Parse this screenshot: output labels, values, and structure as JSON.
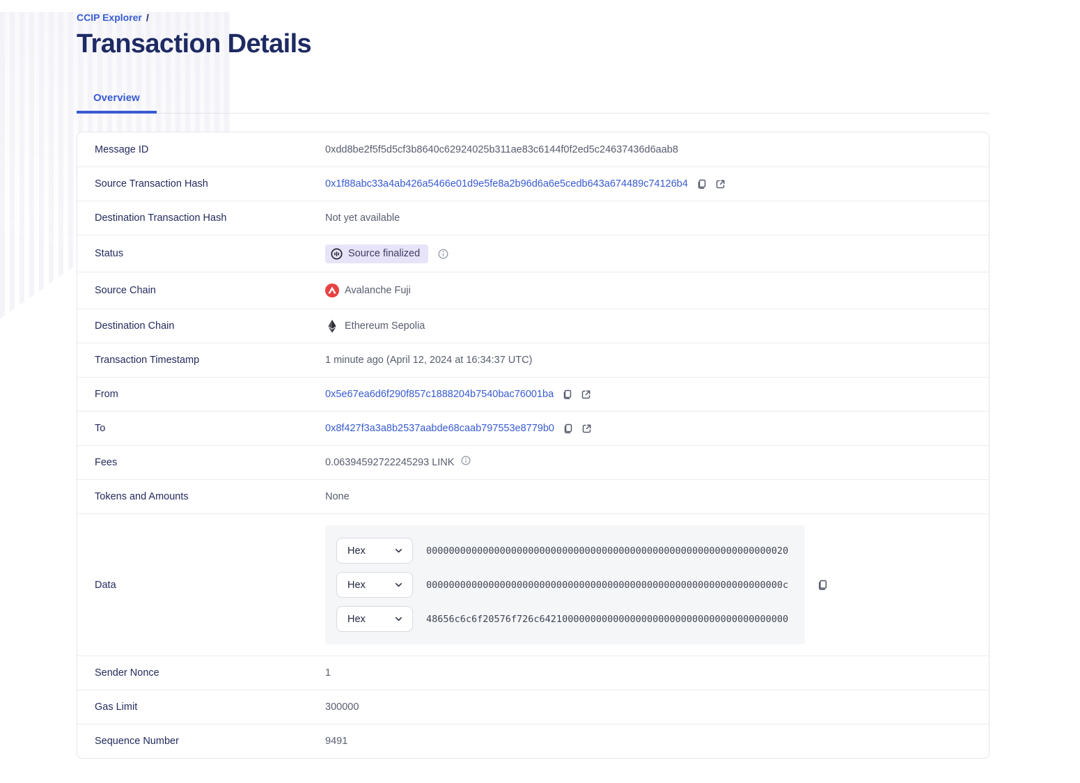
{
  "breadcrumb": {
    "link_label": "CCIP Explorer",
    "separator": "/"
  },
  "page": {
    "title": "Transaction Details"
  },
  "tabs": {
    "overview_label": "Overview"
  },
  "colors": {
    "accent_blue": "#375BD2",
    "heading_navy": "#1E2A63",
    "value_gray": "#575D6F",
    "badge_bg": "#E7E3F9",
    "badge_text": "#3F3D63",
    "avalanche_red": "#E84142",
    "ethereum_dark": "#2B2B33",
    "data_box_bg": "#F5F6F8"
  },
  "rows": {
    "message_id": {
      "label": "Message ID",
      "value": "0xdd8be2f5f5d5cf3b8640c62924025b311ae83c6144f0f2ed5c24637436d6aab8"
    },
    "source_tx": {
      "label": "Source Transaction Hash",
      "value": "0x1f88abc33a4ab426a5466e01d9e5fe8a2b96d6a6e5cedb643a674489c74126b4"
    },
    "dest_tx": {
      "label": "Destination Transaction Hash",
      "value": "Not yet available"
    },
    "status": {
      "label": "Status",
      "badge_label": "Source finalized"
    },
    "source_chain": {
      "label": "Source Chain",
      "value": "Avalanche Fuji"
    },
    "dest_chain": {
      "label": "Destination Chain",
      "value": "Ethereum Sepolia"
    },
    "timestamp": {
      "label": "Transaction Timestamp",
      "value": "1 minute ago (April 12, 2024 at 16:34:37 UTC)"
    },
    "from": {
      "label": "From",
      "value": "0x5e67ea6d6f290f857c1888204b7540bac76001ba"
    },
    "to": {
      "label": "To",
      "value": "0x8f427f3a3a8b2537aabde68caab797553e8779b0"
    },
    "fees": {
      "label": "Fees",
      "value": "0.06394592722245293 LINK"
    },
    "tokens": {
      "label": "Tokens and Amounts",
      "value": "None"
    },
    "data": {
      "label": "Data",
      "encoding": "Hex",
      "lines": [
        "0000000000000000000000000000000000000000000000000000000000000020",
        "000000000000000000000000000000000000000000000000000000000000000c",
        "48656c6c6f20576f726c64210000000000000000000000000000000000000000"
      ]
    },
    "sender_nonce": {
      "label": "Sender Nonce",
      "value": "1"
    },
    "gas_limit": {
      "label": "Gas Limit",
      "value": "300000"
    },
    "sequence_number": {
      "label": "Sequence Number",
      "value": "9491"
    }
  }
}
